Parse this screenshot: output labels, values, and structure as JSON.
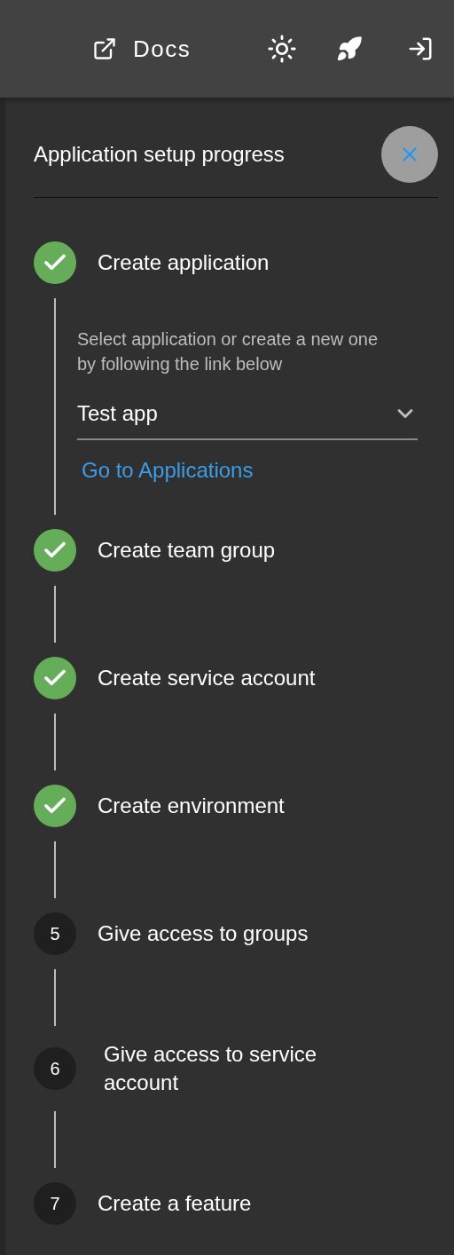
{
  "toolbar": {
    "docs_link": "Docs"
  },
  "panel": {
    "title": "Application setup progress"
  },
  "steps": [
    {
      "label": "Create application",
      "completed": true,
      "description": "Select application or create a new one by following the link below",
      "select": {
        "value": "Test app"
      },
      "link": "Go to Applications"
    },
    {
      "label": "Create team group",
      "completed": true
    },
    {
      "label": "Create service account",
      "completed": true
    },
    {
      "label": "Create environment",
      "completed": true
    },
    {
      "label": "Give access to groups",
      "completed": false,
      "number": "5"
    },
    {
      "label": "Give access to service account",
      "completed": false,
      "number": "6"
    },
    {
      "label": "Create a feature",
      "completed": false,
      "number": "7"
    }
  ]
}
